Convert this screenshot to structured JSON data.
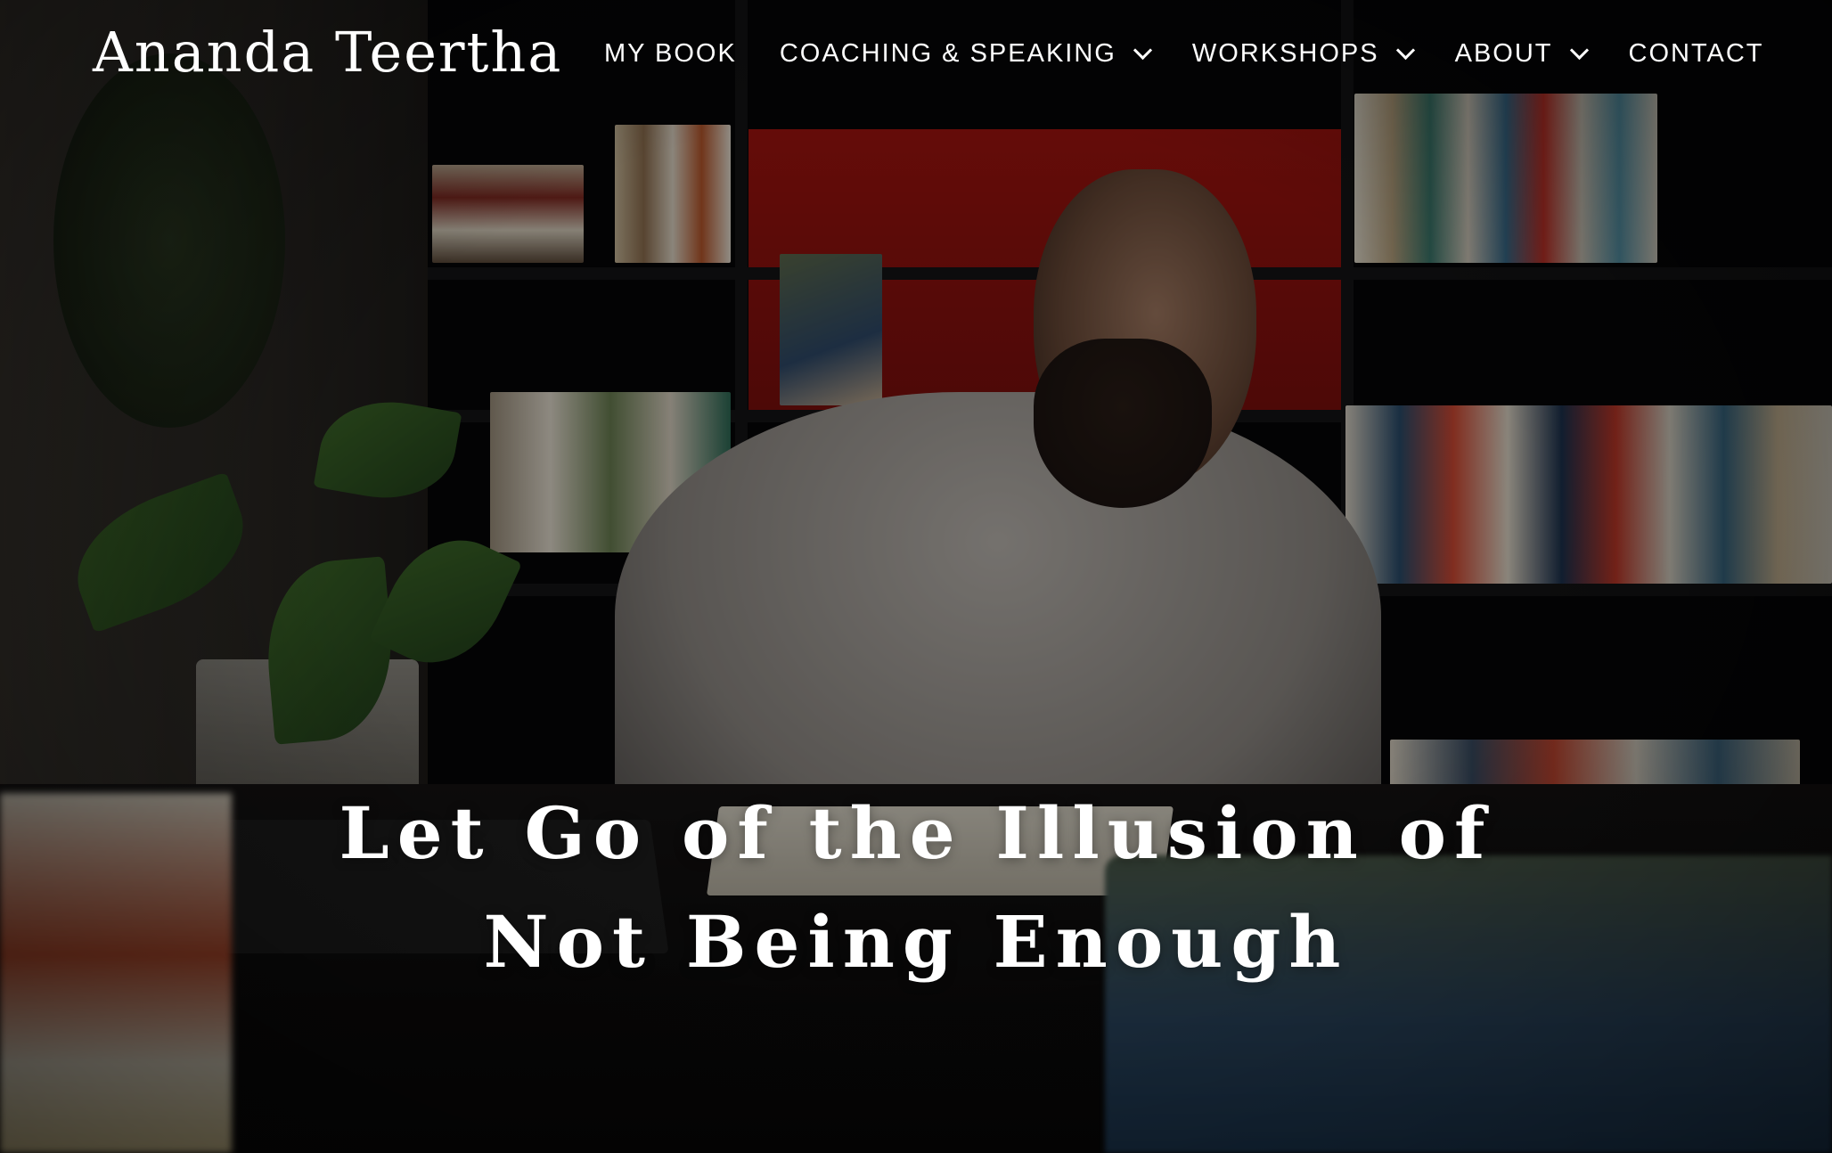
{
  "site": {
    "title": "Ananda Teertha"
  },
  "nav": {
    "items": [
      {
        "label": "MY BOOK",
        "has_dropdown": false
      },
      {
        "label": "COACHING & SPEAKING",
        "has_dropdown": true
      },
      {
        "label": "WORKSHOPS",
        "has_dropdown": true
      },
      {
        "label": "ABOUT",
        "has_dropdown": true
      },
      {
        "label": "CONTACT",
        "has_dropdown": false
      }
    ]
  },
  "hero": {
    "headline_line1": "Let Go of the Illusion of",
    "headline_line2": "Not Being Enough"
  },
  "icons": {
    "dropdown": "chevron-down-icon"
  },
  "colors": {
    "text": "#ffffff",
    "overlay": "#000000",
    "shelf_accent": "#a3140f"
  }
}
